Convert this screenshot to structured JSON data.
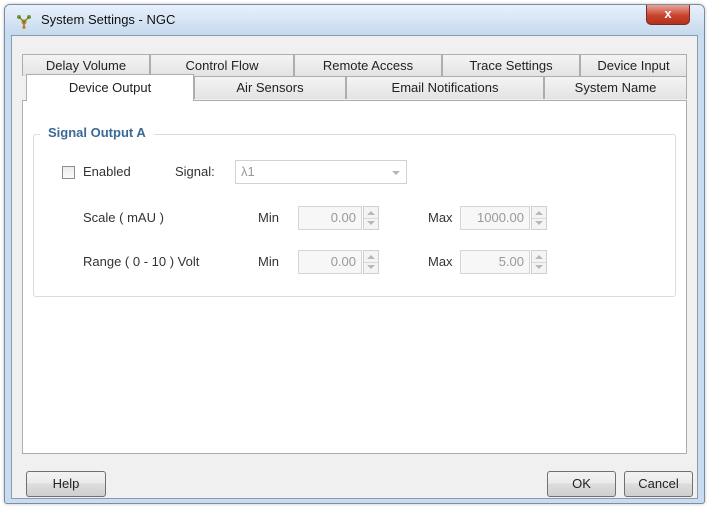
{
  "window": {
    "title": "System Settings - NGC",
    "close_label": "x"
  },
  "tabs": {
    "row1": [
      "Delay Volume",
      "Control Flow",
      "Remote Access",
      "Trace Settings",
      "Device Input"
    ],
    "row2": [
      "Device Output",
      "Air Sensors",
      "Email Notifications",
      "System Name"
    ],
    "active": "Device Output"
  },
  "signal_output": {
    "group_title": "Signal Output A",
    "enabled_label": "Enabled",
    "enabled_checked": false,
    "signal_label": "Signal:",
    "signal_value": "λ1",
    "scale": {
      "label": "Scale ( mAU )",
      "min_label": "Min",
      "min_value": "0.00",
      "max_label": "Max",
      "max_value": "1000.00"
    },
    "range": {
      "label": "Range ( 0 - 10 ) Volt",
      "min_label": "Min",
      "min_value": "0.00",
      "max_label": "Max",
      "max_value": "5.00"
    }
  },
  "buttons": {
    "help": "Help",
    "ok": "OK",
    "cancel": "Cancel"
  },
  "icons": {
    "app": "app-molecule-icon",
    "close": "close-icon",
    "dropdown": "chevron-down-icon",
    "spinner": "spinner-arrows-icon"
  }
}
